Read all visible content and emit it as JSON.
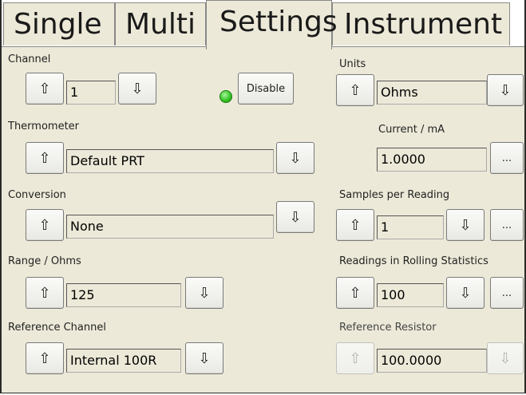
{
  "tabs": [
    {
      "label": "Single"
    },
    {
      "label": "Multi"
    },
    {
      "label": "Settings"
    },
    {
      "label": "Instrument"
    }
  ],
  "icons": {
    "up": "⇧",
    "down": "⇩",
    "more": "..."
  },
  "left": {
    "channel": {
      "label": "Channel",
      "value": "1",
      "disable_label": "Disable",
      "status_color": "#2fc21f"
    },
    "thermometer": {
      "label": "Thermometer",
      "value": "Default PRT"
    },
    "conversion": {
      "label": "Conversion",
      "value": "None"
    },
    "range": {
      "label": "Range / Ohms",
      "value": "125"
    },
    "reference_channel": {
      "label": "Reference Channel",
      "value": "Internal 100R"
    }
  },
  "right": {
    "units": {
      "label": "Units",
      "value": "Ohms"
    },
    "current": {
      "label": "Current / mA",
      "value": "1.0000"
    },
    "samples": {
      "label": "Samples per Reading",
      "value": "1"
    },
    "readings": {
      "label": "Readings in Rolling Statistics",
      "value": "100"
    },
    "reference_resistor": {
      "label": "Reference Resistor",
      "value": "100.0000"
    }
  }
}
